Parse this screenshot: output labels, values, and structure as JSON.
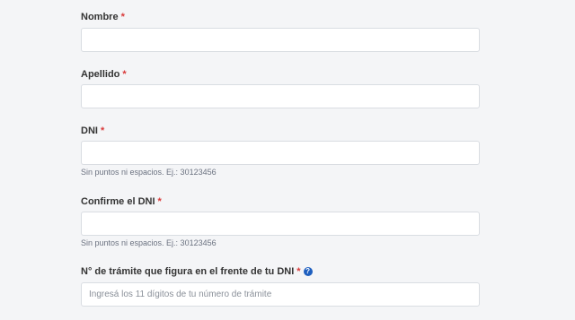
{
  "fields": {
    "nombre": {
      "label": "Nombre",
      "required_mark": "*",
      "value": "",
      "placeholder": ""
    },
    "apellido": {
      "label": "Apellido",
      "required_mark": "*",
      "value": "",
      "placeholder": ""
    },
    "dni": {
      "label": "DNI",
      "required_mark": "*",
      "value": "",
      "placeholder": "",
      "hint": "Sin puntos ni espacios. Ej.: 30123456"
    },
    "confirm_dni": {
      "label": "Confirme el DNI",
      "required_mark": "*",
      "value": "",
      "placeholder": "",
      "hint": "Sin puntos ni espacios. Ej.: 30123456"
    },
    "tramite": {
      "label": "N° de trámite que figura en el frente de tu DNI",
      "required_mark": "*",
      "help_icon": "question-circle-icon",
      "help_glyph": "?",
      "value": "",
      "placeholder": "Ingresá los 11 dígitos de tu número de trámite"
    }
  },
  "colors": {
    "background": "#f4f5f7",
    "required_mark": "#d93a3a",
    "help_icon": "#1e5fbf"
  }
}
